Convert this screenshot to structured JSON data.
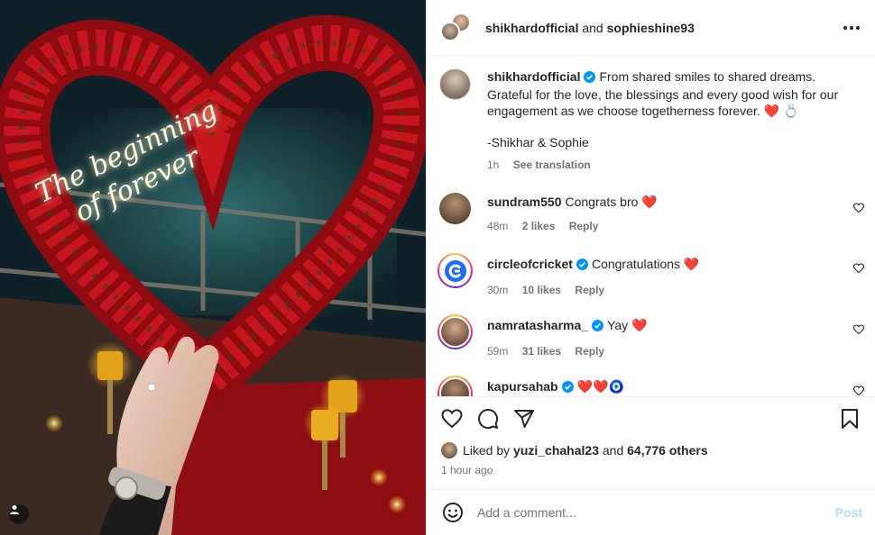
{
  "header": {
    "user1": "shikhardofficial",
    "and": "and",
    "user2": "sophieshine93"
  },
  "photo": {
    "neon_line1": "The beginning",
    "neon_line2": "of forever"
  },
  "caption": {
    "username": "shikhardofficial",
    "text": "From shared smiles to shared dreams. Grateful for the love, the blessings and every good wish for our engagement as we choose togetherness forever. ❤️ 💍",
    "signature": "-Shikhar & Sophie",
    "time": "1h",
    "translate": "See translation"
  },
  "comments": [
    {
      "username": "sundram550",
      "verified": false,
      "text": "Congrats bro ❤️",
      "time": "48m",
      "likes": "2 likes",
      "reply": "Reply"
    },
    {
      "username": "circleofcricket",
      "verified": true,
      "text": "Congratulations ❤️",
      "time": "30m",
      "likes": "10 likes",
      "reply": "Reply"
    },
    {
      "username": "namratasharma_",
      "verified": true,
      "text": "Yay ❤️",
      "time": "59m",
      "likes": "31 likes",
      "reply": "Reply"
    },
    {
      "username": "kapursahab",
      "verified": true,
      "text": "❤️❤️🧿",
      "time": "",
      "likes": "",
      "reply": ""
    }
  ],
  "likes": {
    "prefix": "Liked by",
    "user": "yuzi_chahal23",
    "middle": "and",
    "others": "64,776 others"
  },
  "post_time": "1 hour ago",
  "comment_box": {
    "placeholder": "Add a comment...",
    "post_label": "Post"
  },
  "colors": {
    "verified": "#0095f6",
    "heart": "#ed4956",
    "post_disabled": "#b3dbff"
  },
  "icons": [
    "more-icon",
    "like-icon",
    "comment-icon",
    "share-icon",
    "save-icon",
    "emoji-icon",
    "user-tag-icon",
    "verified-icon",
    "heart-small-icon"
  ]
}
